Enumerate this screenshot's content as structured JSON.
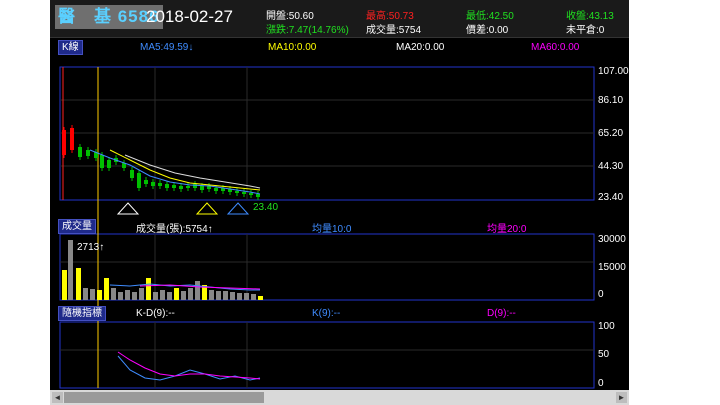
{
  "header": {
    "stock": "醫　基 6586",
    "date": "2018-02-27",
    "open": "開盤:50.60",
    "high": "最高:50.73",
    "low": "最低:42.50",
    "close": "收盤:43.13",
    "change": "漲跌:7.47(14.76%)",
    "volume": "成交量:5754",
    "spread": "價差:0.00",
    "unclosed": "未平倉:0"
  },
  "price_panel": {
    "title": "K線",
    "ma5": "MA5:49.59↓",
    "ma10": "MA10:0.00",
    "ma20": "MA20:0.00",
    "ma60": "MA60:0.00",
    "axis": [
      "107.00",
      "86.10",
      "65.20",
      "44.30",
      "23.40"
    ],
    "markers": [
      "20",
      "10",
      "5"
    ],
    "low_label": "23.40",
    "colors": {
      "ma5": "#3f8cff",
      "ma10": "#ffff00",
      "ma20": "#ffffff",
      "ma60": "#ff00ff",
      "up": "#ff0000",
      "down": "#00c000"
    }
  },
  "volume_panel": {
    "title": "成交量",
    "vol": "成交量(張):5754↑",
    "ma10": "均量10:0",
    "ma20": "均量20:0",
    "peak": "2713↑",
    "axis": [
      "30000",
      "15000",
      "0"
    ]
  },
  "kd_panel": {
    "title": "隨機指標",
    "kd": "K-D(9):--",
    "k": "K(9):--",
    "d": "D(9):--",
    "axis": [
      "100",
      "50",
      "0"
    ]
  },
  "scrollbar": {
    "left_icon": "◄",
    "right_icon": "►"
  }
}
